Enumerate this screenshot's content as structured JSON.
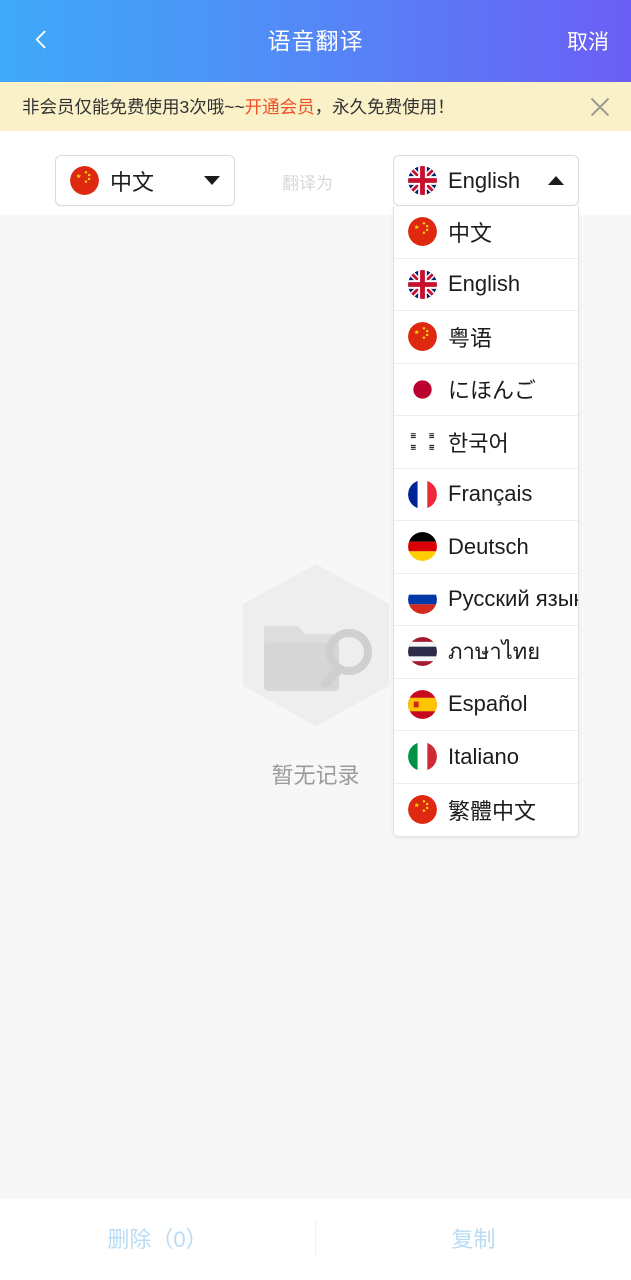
{
  "header": {
    "title": "语音翻译",
    "back_icon": "chevron-left-icon",
    "action_label": "取消"
  },
  "banner": {
    "text_before": "非会员仅能免费使用3次哦~~",
    "link_text": "开通会员",
    "text_after": "，永久免费使用！",
    "close_icon": "close-icon",
    "bg_color": "#faf1c9",
    "link_color": "#f04f24"
  },
  "selector": {
    "source": {
      "flag": "flag-china",
      "label": "中文",
      "caret_icon": "chevron-down-icon",
      "expanded": false
    },
    "middle_label": "翻译为",
    "target": {
      "flag": "flag-uk",
      "label": "English",
      "caret_icon": "chevron-up-icon",
      "expanded": true
    }
  },
  "dropdown": {
    "open": true,
    "items": [
      {
        "flag": "flag-china",
        "label": "中文"
      },
      {
        "flag": "flag-uk",
        "label": "English"
      },
      {
        "flag": "flag-china",
        "label": "粤语"
      },
      {
        "flag": "flag-japan",
        "label": "にほんご"
      },
      {
        "flag": "flag-korea",
        "label": "한국어"
      },
      {
        "flag": "flag-france",
        "label": "Français"
      },
      {
        "flag": "flag-germany",
        "label": "Deutsch"
      },
      {
        "flag": "flag-russia",
        "label": "Русский язык"
      },
      {
        "flag": "flag-thailand",
        "label": "ภาษาไทย"
      },
      {
        "flag": "flag-spain",
        "label": "Español"
      },
      {
        "flag": "flag-italy",
        "label": "Italiano"
      },
      {
        "flag": "flag-china",
        "label": "繁體中文"
      }
    ]
  },
  "main": {
    "empty_state_icon": "folder-search-icon",
    "empty_state_label": "暂无记录"
  },
  "bottom_bar": {
    "delete_label": "删除（0）",
    "copy_label": "复制",
    "text_color": "#b8dcf5"
  },
  "theme": {
    "header_gradient_start": "#3fa9f8",
    "header_gradient_end": "#6b5ef5",
    "body_bg": "#f7f7f7",
    "card_bg": "#ffffff"
  }
}
